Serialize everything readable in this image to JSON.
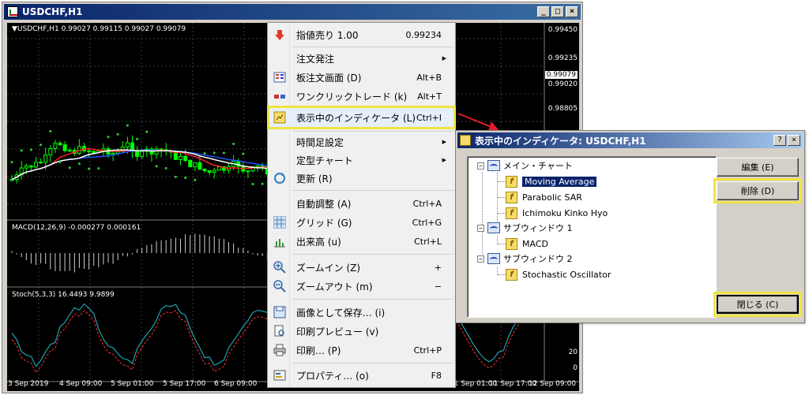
{
  "window": {
    "title": "USDCHF,H1",
    "buttons": {
      "minimize": "_",
      "maximize": "□",
      "close": "×"
    }
  },
  "chart": {
    "main_label": "▼USDCHF,H1  0.99027 0.99115 0.99027 0.99079",
    "macd_label": "MACD(12,26,9) -0.000277 0.000161",
    "stoch_label": "Stoch(5,3,3) 16.4493 9.9899",
    "prices": [
      "0.99450",
      "0.99235",
      "0.99079",
      "0.99020",
      "0.98805"
    ],
    "stoch_levels": [
      "20",
      "0"
    ],
    "time_ticks": [
      "3 Sep 2019",
      "4 Sep 09:00",
      "5 Sep 01:00",
      "5 Sep 17:00",
      "6 Sep 09:00",
      "9 Sep 01:00",
      "9 Sep 17:00",
      "10 Sep 09:00",
      "11 Sep 01:00",
      "11 Sep 17:00",
      "12 Sep 09:00"
    ]
  },
  "menu": {
    "items": [
      {
        "label": "指値売り  1.00",
        "shortcut": "0.99234",
        "icon": "sell-arrow-icon"
      },
      {
        "label": "注文発注",
        "submenu": true
      },
      {
        "label": "板注文画面 (D)",
        "shortcut": "Alt+B",
        "icon": "dom-icon"
      },
      {
        "label": "ワンクリックトレード (k)",
        "shortcut": "Alt+T",
        "icon": "one-click-icon"
      },
      {
        "label": "表示中のインディケータ (L)",
        "shortcut": "Ctrl+I",
        "icon": "indicators-icon"
      },
      {
        "label": "時間足設定",
        "submenu": true
      },
      {
        "label": "定型チャート",
        "submenu": true
      },
      {
        "label": "更新 (R)",
        "icon": "refresh-icon"
      },
      {
        "label": "自動調整 (A)",
        "shortcut": "Ctrl+A"
      },
      {
        "label": "グリッド (G)",
        "shortcut": "Ctrl+G",
        "icon": "grid-icon"
      },
      {
        "label": "出来高 (u)",
        "shortcut": "Ctrl+L",
        "icon": "volume-icon"
      },
      {
        "label": "ズームイン (Z)",
        "shortcut": "+",
        "icon": "zoom-in-icon"
      },
      {
        "label": "ズームアウト (m)",
        "shortcut": "−",
        "icon": "zoom-out-icon"
      },
      {
        "label": "画像として保存… (i)",
        "icon": "save-image-icon"
      },
      {
        "label": "印刷プレビュー (v)",
        "icon": "print-preview-icon"
      },
      {
        "label": "印刷… (P)",
        "shortcut": "Ctrl+P",
        "icon": "print-icon"
      },
      {
        "label": "プロパティ… (o)",
        "shortcut": "F8",
        "icon": "properties-icon"
      }
    ]
  },
  "dialog": {
    "title": "表示中のインディケータ: USDCHF,H1",
    "title_buttons": {
      "help": "?",
      "close": "×"
    },
    "tree": {
      "main": "メイン・チャート",
      "main_items": [
        "Moving Average",
        "Parabolic SAR",
        "Ichimoku Kinko Hyo"
      ],
      "sub1": "サブウィンドウ 1",
      "sub1_items": [
        "MACD"
      ],
      "sub2": "サブウィンドウ 2",
      "sub2_items": [
        "Stochastic Oscillator"
      ],
      "selected": "Moving Average"
    },
    "buttons": {
      "edit": "編集 (E)",
      "delete": "削除 (D)",
      "close": "閉じる (C)"
    }
  },
  "colors": {
    "highlight": "#f0e442",
    "arrow": "#e8192c",
    "chart_bg": "#000000"
  }
}
